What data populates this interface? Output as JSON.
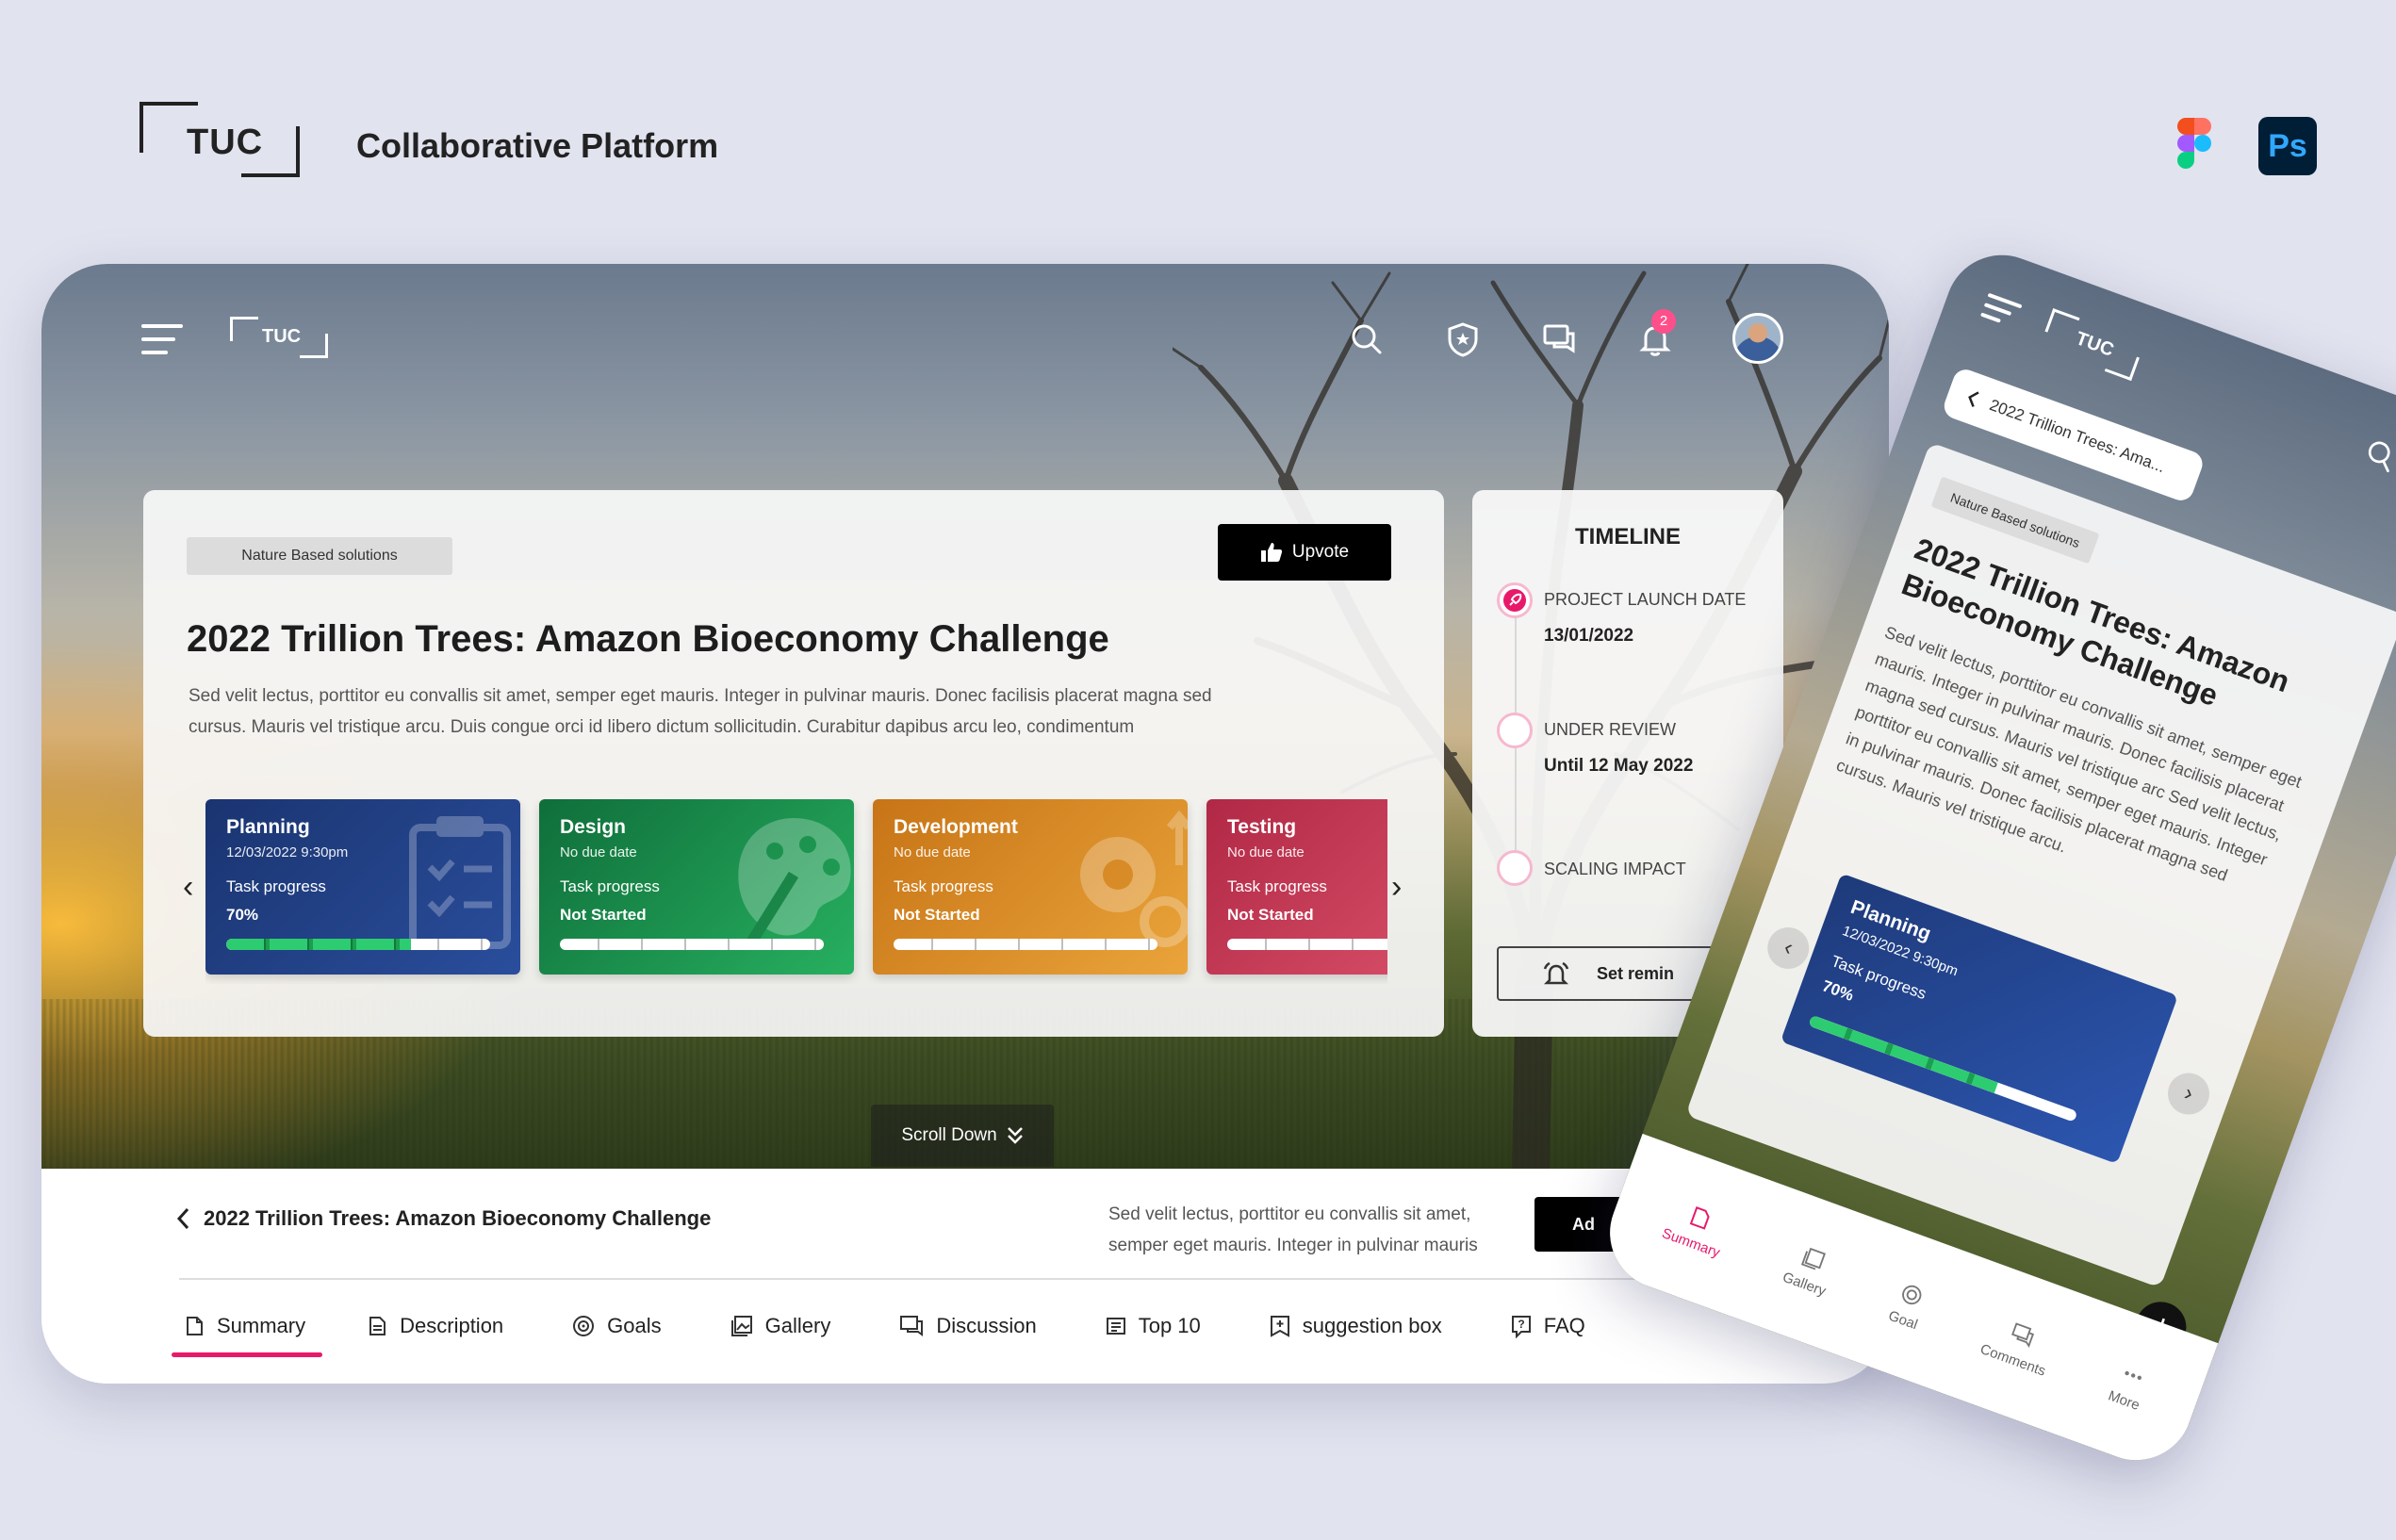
{
  "branding": {
    "logo_text": "TUC",
    "title": "Collaborative Platform",
    "tools": [
      "figma-icon",
      "photoshop-icon"
    ],
    "ps_label": "Ps"
  },
  "desktop": {
    "logo_text": "TUC",
    "header_icons": [
      "menu-icon",
      "search-icon",
      "shield-icon",
      "chat-icon",
      "bell-icon",
      "avatar"
    ],
    "notifications": "2",
    "card": {
      "tag": "Nature Based solutions",
      "upvote": "Upvote",
      "title": "2022 Trillion Trees: Amazon Bioeconomy Challenge",
      "description": "Sed velit lectus, porttitor eu convallis sit amet, semper eget mauris. Integer in pulvinar mauris. Donec facilisis placerat magna sed cursus. Mauris vel tristique arcu. Duis congue orci id libero dictum sollicitudin. Curabitur dapibus arcu leo, condimentum"
    },
    "tasks": [
      {
        "name": "Planning",
        "date": "12/03/2022  9:30pm",
        "progress_label": "Task progress",
        "progress": "70%",
        "progress_fraction": 0.7,
        "color": "#1f3f84"
      },
      {
        "name": "Design",
        "date": "No due date",
        "progress_label": "Task progress",
        "progress": "Not Started",
        "progress_fraction": 0,
        "color": "#1a8a49"
      },
      {
        "name": "Development",
        "date": "No due date",
        "progress_label": "Task progress",
        "progress": "Not Started",
        "progress_fraction": 0,
        "color": "#d88a22"
      },
      {
        "name": "Testing",
        "date": "No due date",
        "progress_label": "Task progress",
        "progress": "Not Started",
        "progress_fraction": 0,
        "color": "#c0334f"
      }
    ],
    "timeline": {
      "title": "TIMELINE",
      "items": [
        {
          "label": "PROJECT LAUNCH DATE",
          "value": "13/01/2022"
        },
        {
          "label": "UNDER REVIEW",
          "value": "Until 12 May 2022"
        },
        {
          "label": "SCALING IMPACT",
          "value": ""
        }
      ],
      "reminder": "Set remin"
    },
    "scroll_down": "Scroll Down",
    "bottom": {
      "breadcrumb": "2022 Trillion Trees: Amazon Bioeconomy Challenge",
      "description": "Sed velit lectus, porttitor eu convallis sit amet, semper eget mauris. Integer in pulvinar mauris",
      "button": "Ad",
      "tabs": [
        {
          "label": "Summary",
          "icon": "summary-icon"
        },
        {
          "label": "Description",
          "icon": "document-icon"
        },
        {
          "label": "Goals",
          "icon": "goal-icon"
        },
        {
          "label": "Gallery",
          "icon": "gallery-icon"
        },
        {
          "label": "Discussion",
          "icon": "discussion-icon"
        },
        {
          "label": "Top 10",
          "icon": "top10-icon"
        },
        {
          "label": "suggestion box",
          "icon": "suggestion-icon"
        },
        {
          "label": "FAQ",
          "icon": "faq-icon"
        }
      ],
      "active_tab": "Summary"
    }
  },
  "mobile": {
    "logo_text": "TUC",
    "notifications": "2",
    "back_title": "2022 Trillion Trees: Ama...",
    "tag": "Nature Based solutions",
    "title": "2022 Trillion Trees: Amazon Bioeconomy Challenge",
    "description": "Sed velit lectus, porttitor eu convallis sit amet, semper eget mauris. Integer in pulvinar mauris. Donec facilisis placerat magna sed cursus. Mauris vel tristique arc Sed velit lectus, porttitor eu convallis sit amet, semper eget mauris. Integer in pulvinar mauris. Donec facilisis placerat magna sed cursus. Mauris vel tristique arcu.",
    "task": {
      "name": "Planning",
      "date": "12/03/2022  9:30pm",
      "progress_label": "Task progress",
      "progress": "70%",
      "progress_fraction": 0.7
    },
    "nav": [
      {
        "label": "Summary",
        "icon": "summary-icon"
      },
      {
        "label": "Gallery",
        "icon": "gallery-icon"
      },
      {
        "label": "Goal",
        "icon": "goal-icon"
      },
      {
        "label": "Comments",
        "icon": "comments-icon"
      },
      {
        "label": "More",
        "icon": "more-icon"
      }
    ],
    "fab": "+"
  },
  "colors": {
    "accent": "#e8196b",
    "badge": "#ff4f8b",
    "background": "#e1e3ef"
  }
}
